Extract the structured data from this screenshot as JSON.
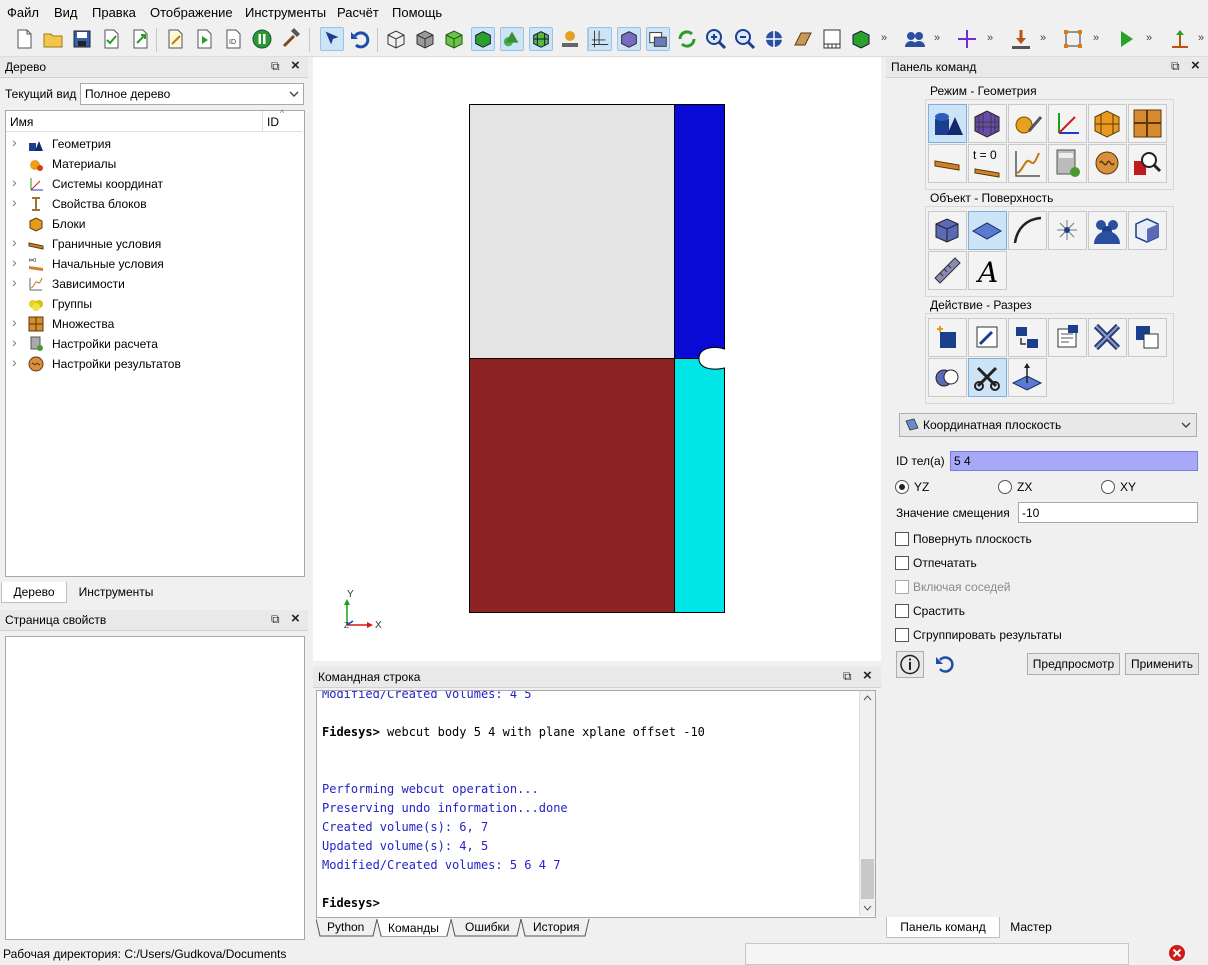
{
  "menu": [
    "Файл",
    "Вид",
    "Правка",
    "Отображение",
    "Инструменты",
    "Расчёт",
    "Помощь"
  ],
  "tree_panel": {
    "title": "Дерево",
    "current_view_label": "Текущий вид",
    "current_view_value": "Полное дерево",
    "col_name": "Имя",
    "col_id": "ID",
    "items": [
      {
        "label": "Геометрия",
        "icon": "geometry-icon",
        "expandable": true
      },
      {
        "label": "Материалы",
        "icon": "materials-icon",
        "expandable": false
      },
      {
        "label": "Системы координат",
        "icon": "coord-systems-icon",
        "expandable": true
      },
      {
        "label": "Свойства блоков",
        "icon": "block-props-icon",
        "expandable": true
      },
      {
        "label": "Блоки",
        "icon": "blocks-icon",
        "expandable": false
      },
      {
        "label": "Граничные условия",
        "icon": "bc-icon",
        "expandable": true
      },
      {
        "label": "Начальные условия",
        "icon": "ic-icon",
        "expandable": true
      },
      {
        "label": "Зависимости",
        "icon": "dependencies-icon",
        "expandable": true
      },
      {
        "label": "Группы",
        "icon": "groups-icon",
        "expandable": false
      },
      {
        "label": "Множества",
        "icon": "sets-icon",
        "expandable": true
      },
      {
        "label": "Настройки расчета",
        "icon": "calc-settings-icon",
        "expandable": true
      },
      {
        "label": "Настройки результатов",
        "icon": "results-settings-icon",
        "expandable": true
      }
    ],
    "tabs": [
      "Дерево",
      "Инструменты"
    ]
  },
  "props_panel": {
    "title": "Страница свойств"
  },
  "viewport": {
    "axis_y": "Y",
    "axis_x": "X",
    "axis_z": "Z",
    "colors": {
      "top_left": "#e4e4e4",
      "top_right": "#0a0ad6",
      "bottom_left": "#8e2323",
      "bottom_right": "#00e5e5"
    }
  },
  "command_line": {
    "title": "Командная строка",
    "prompt": "Fidesys>",
    "lines": [
      {
        "type": "out",
        "text": "Modified/Created volumes: 4 5"
      },
      {
        "type": "cmd",
        "text": " webcut body 5 4 with plane xplane offset -10"
      },
      {
        "type": "out",
        "text": "Performing webcut operation..."
      },
      {
        "type": "out",
        "text": "Preserving undo information...done"
      },
      {
        "type": "out",
        "text": "Created volume(s): 6, 7"
      },
      {
        "type": "out",
        "text": "Updated volume(s): 4, 5"
      },
      {
        "type": "out",
        "text": "Modified/Created volumes: 5 6 4 7"
      },
      {
        "type": "cmd",
        "text": ""
      }
    ],
    "tabs": [
      "Python",
      "Команды",
      "Ошибки",
      "История"
    ]
  },
  "command_panel": {
    "title": "Панель команд",
    "group1": "Режим - Геометрия",
    "group2": "Объект - Поверхность",
    "group3": "Действие - Разрез",
    "t0_label": "t = 0",
    "plane_type": "Координатная плоскость",
    "body_id_label": "ID тел(а)",
    "body_id_value": "5 4",
    "radio": [
      "YZ",
      "ZX",
      "XY"
    ],
    "offset_label": "Значение смещения",
    "offset_value": "-10",
    "checks": {
      "rotate": "Повернуть плоскость",
      "imprint": "Отпечатать",
      "neighbors": "Включая соседей",
      "merge": "Срастить",
      "group": "Сгруппировать результаты"
    },
    "preview": "Предпросмотр",
    "apply": "Применить",
    "tabs": [
      "Панель команд",
      "Мастер"
    ]
  },
  "status": {
    "workdir": "Рабочая директория: C:/Users/Gudkova/Documents"
  }
}
